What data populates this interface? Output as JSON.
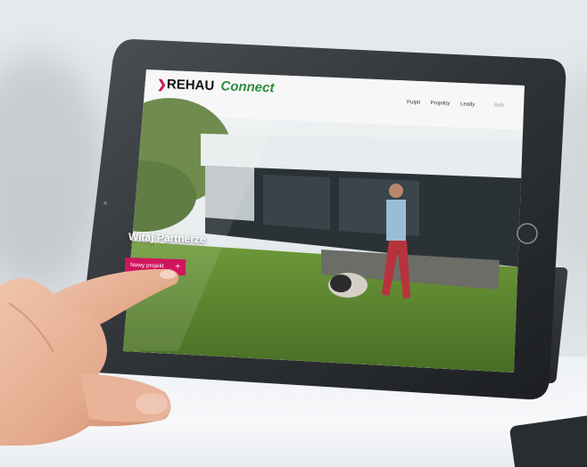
{
  "app": {
    "logo_brand": "REHAU",
    "logo_product": "Connect"
  },
  "nav": {
    "items": [
      {
        "label": "Pulpit"
      },
      {
        "label": "Projekty"
      },
      {
        "label": "Leady"
      },
      {
        "label": "Reh"
      }
    ]
  },
  "hero": {
    "welcome": "Witaj Partnerze",
    "new_project_label": "Nowy projekt",
    "new_project_icon": "plus-icon"
  },
  "colors": {
    "brand_green": "#2e8b3f",
    "accent_pink": "#d0155d"
  }
}
